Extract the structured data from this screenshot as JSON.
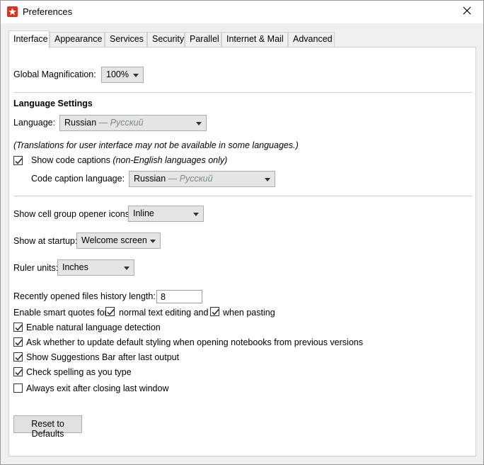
{
  "window": {
    "title": "Preferences"
  },
  "tabs": [
    "Interface",
    "Appearance",
    "Services",
    "Security",
    "Parallel",
    "Internet & Mail",
    "Advanced"
  ],
  "global_magnification": {
    "label": "Global Magnification:",
    "value": "100%"
  },
  "language_settings": {
    "heading": "Language Settings",
    "language_label": "Language:",
    "language_value": "Russian",
    "language_native": "— Русский",
    "note": "(Translations for user interface may not be available in some languages.)",
    "show_code_captions": {
      "label": "Show code captions",
      "suffix": "(non-English languages only)",
      "checked": true
    },
    "code_caption_label": "Code caption language:",
    "code_caption_value": "Russian",
    "code_caption_native": "— Русский"
  },
  "cell_group": {
    "label": "Show cell group opener icons:",
    "value": "Inline"
  },
  "startup": {
    "label": "Show at startup:",
    "value": "Welcome screen"
  },
  "ruler": {
    "label": "Ruler units:",
    "value": "Inches"
  },
  "history": {
    "label": "Recently opened files history length:",
    "value": "8"
  },
  "smart_quotes": {
    "label": "Enable smart quotes for",
    "opt1": {
      "label": "normal text editing and",
      "checked": true
    },
    "opt2": {
      "label": "when pasting",
      "checked": true
    }
  },
  "checkboxes": [
    {
      "label": "Enable natural language detection",
      "checked": true
    },
    {
      "label": "Ask whether to update default styling when opening notebooks from previous versions",
      "checked": true
    },
    {
      "label": "Show Suggestions Bar after last output",
      "checked": true
    },
    {
      "label": "Check spelling as you type",
      "checked": true
    },
    {
      "label": "Always exit after closing last window",
      "checked": false
    }
  ],
  "reset_button": "Reset to Defaults",
  "colors": {
    "accent": "#d9341f",
    "panel": "#ffffff",
    "window_bg": "#f0f0f0"
  }
}
